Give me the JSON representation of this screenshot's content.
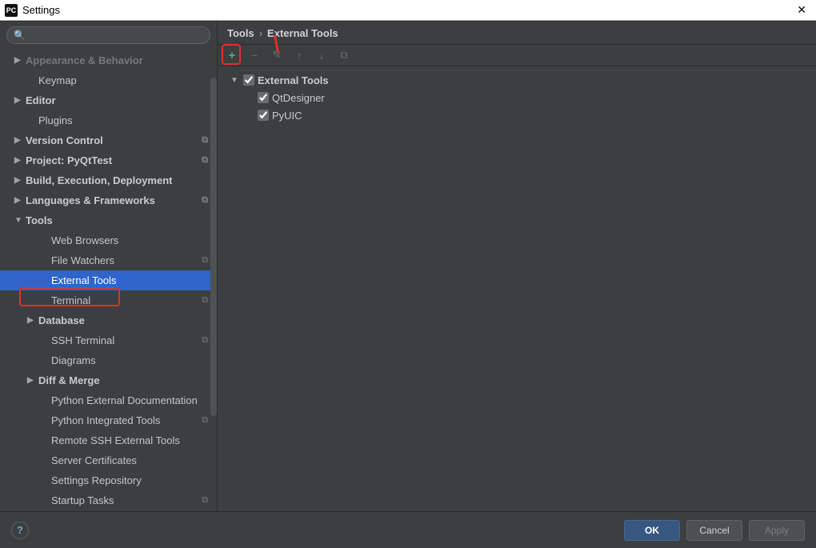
{
  "window": {
    "title": "Settings",
    "app_icon_text": "PC"
  },
  "sidebar": {
    "search_placeholder": "",
    "items": [
      {
        "label": "Appearance & Behavior",
        "type": "group",
        "expanded": false,
        "faded": true
      },
      {
        "label": "Keymap",
        "type": "leaf",
        "indent": 1
      },
      {
        "label": "Editor",
        "type": "group",
        "expanded": false
      },
      {
        "label": "Plugins",
        "type": "leaf",
        "indent": 1
      },
      {
        "label": "Version Control",
        "type": "group",
        "expanded": false,
        "badge": true
      },
      {
        "label": "Project: PyQtTest",
        "type": "group",
        "expanded": false,
        "badge": true
      },
      {
        "label": "Build, Execution, Deployment",
        "type": "group",
        "expanded": false
      },
      {
        "label": "Languages & Frameworks",
        "type": "group",
        "expanded": false,
        "badge": true
      },
      {
        "label": "Tools",
        "type": "group",
        "expanded": true
      },
      {
        "label": "Web Browsers",
        "type": "leaf",
        "indent": 2
      },
      {
        "label": "File Watchers",
        "type": "leaf",
        "indent": 2,
        "badge": true
      },
      {
        "label": "External Tools",
        "type": "leaf",
        "indent": 2,
        "selected": true
      },
      {
        "label": "Terminal",
        "type": "leaf",
        "indent": 2,
        "badge": true
      },
      {
        "label": "Database",
        "type": "group",
        "indent": 1,
        "expanded": false
      },
      {
        "label": "SSH Terminal",
        "type": "leaf",
        "indent": 2,
        "badge": true
      },
      {
        "label": "Diagrams",
        "type": "leaf",
        "indent": 2
      },
      {
        "label": "Diff & Merge",
        "type": "group",
        "indent": 1,
        "expanded": false
      },
      {
        "label": "Python External Documentation",
        "type": "leaf",
        "indent": 2
      },
      {
        "label": "Python Integrated Tools",
        "type": "leaf",
        "indent": 2,
        "badge": true
      },
      {
        "label": "Remote SSH External Tools",
        "type": "leaf",
        "indent": 2
      },
      {
        "label": "Server Certificates",
        "type": "leaf",
        "indent": 2
      },
      {
        "label": "Settings Repository",
        "type": "leaf",
        "indent": 2
      },
      {
        "label": "Startup Tasks",
        "type": "leaf",
        "indent": 2,
        "badge": true
      }
    ]
  },
  "breadcrumb": {
    "root": "Tools",
    "sep": "›",
    "current": "External Tools"
  },
  "toolbar": {
    "add": "+",
    "remove": "−",
    "edit": "✎",
    "up": "↑",
    "down": "↓",
    "copy": "⧉"
  },
  "external_tools": {
    "root_label": "External Tools",
    "root_checked": true,
    "items": [
      {
        "label": "QtDesigner",
        "checked": true
      },
      {
        "label": "PyUIC",
        "checked": true
      }
    ]
  },
  "footer": {
    "ok": "OK",
    "cancel": "Cancel",
    "apply": "Apply"
  }
}
